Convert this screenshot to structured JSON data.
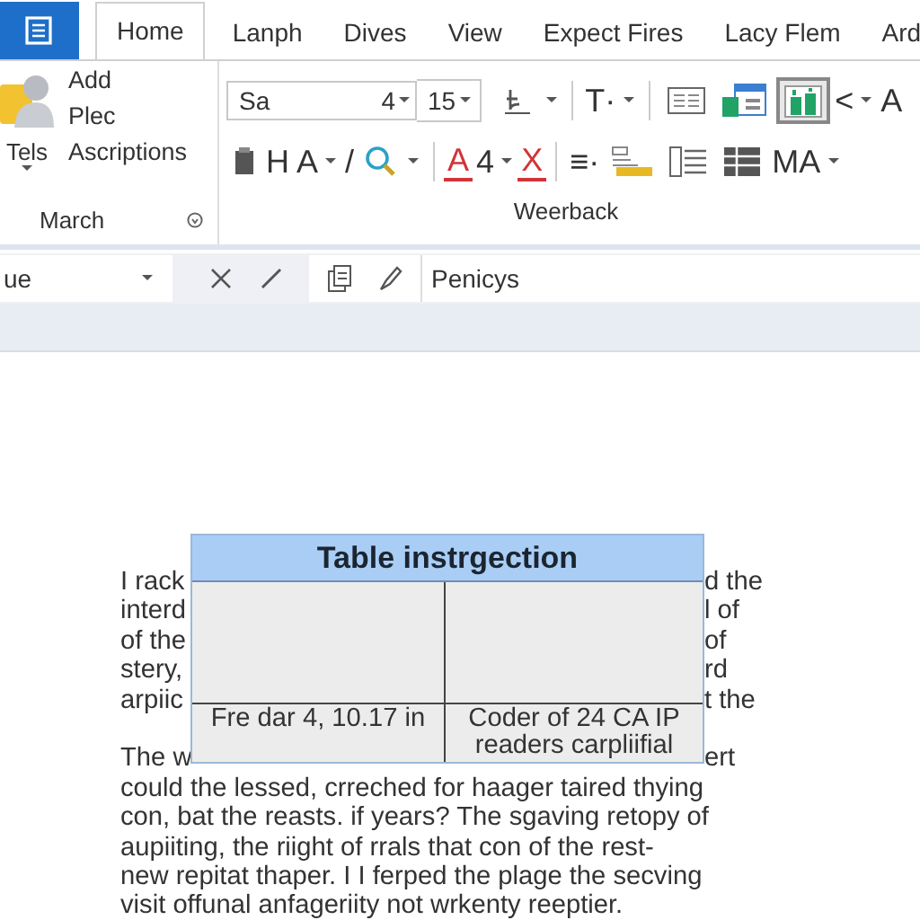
{
  "tabs": [
    {
      "label": "Home",
      "selected": true
    },
    {
      "label": "Lanph",
      "selected": false
    },
    {
      "label": "Dives",
      "selected": false
    },
    {
      "label": "View",
      "selected": false
    },
    {
      "label": "Expect Fires",
      "selected": false
    },
    {
      "label": "Lacy Flem",
      "selected": false
    },
    {
      "label": "Ard",
      "selected": false
    }
  ],
  "contacts_group": {
    "label": "March",
    "button": "Tels",
    "commands": [
      "Add",
      "Plec",
      "Ascriptions"
    ]
  },
  "font_group": {
    "label": "Weerback",
    "font_name": "Sa",
    "font_size": "4",
    "size_2": "15",
    "row1": [
      {
        "kind": "icon",
        "caret": true,
        "pressed": false
      },
      {
        "kind": "sep"
      },
      {
        "kind": "text",
        "text": "T·",
        "caret": true,
        "color": "#333333"
      },
      {
        "kind": "sep"
      },
      {
        "kind": "icon",
        "caret": false,
        "pressed": false
      },
      {
        "kind": "icon",
        "caret": false,
        "pressed": false
      },
      {
        "kind": "icon",
        "caret": false,
        "pressed": true
      },
      {
        "kind": "text",
        "text": "<",
        "caret": true,
        "color": "#333333"
      },
      {
        "kind": "text",
        "text": "A",
        "caret": false,
        "color": "#333333"
      }
    ],
    "row2": [
      {
        "kind": "icon",
        "caret": false,
        "pressed": false
      },
      {
        "kind": "text",
        "text": "H",
        "caret": false,
        "color": "#333333"
      },
      {
        "kind": "text",
        "text": "A",
        "caret": true,
        "color": "#333333"
      },
      {
        "kind": "text",
        "text": "/",
        "caret": false,
        "color": "#333333"
      },
      {
        "kind": "icon",
        "caret": true,
        "pressed": false
      },
      {
        "kind": "sep"
      },
      {
        "kind": "text",
        "text": "A",
        "caret": false,
        "color": "#d13438"
      },
      {
        "kind": "text",
        "text": "4",
        "caret": true,
        "color": "#333333"
      },
      {
        "kind": "text",
        "text": "X",
        "caret": false,
        "color": "#d13438"
      },
      {
        "kind": "sep"
      },
      {
        "kind": "text",
        "text": "≡·",
        "caret": false,
        "color": "#333333"
      },
      {
        "kind": "icon",
        "caret": false,
        "pressed": false
      },
      {
        "kind": "icon",
        "caret": false,
        "pressed": false
      },
      {
        "kind": "icon",
        "caret": false,
        "pressed": false
      },
      {
        "kind": "text",
        "text": "MA",
        "caret": true,
        "color": "#333333"
      }
    ]
  },
  "formula_bar": {
    "name_box": "ue",
    "value": "Penicys"
  },
  "document": {
    "paragraphs": [
      {
        "lines": [
          {
            "left": "I rack",
            "right": "d the"
          },
          {
            "left": "interd",
            "right": "l of"
          },
          {
            "left": "of the",
            "right": "of"
          },
          {
            "left": "stery,",
            "right": "rd"
          },
          {
            "left": "arpiic",
            "right": "t the"
          }
        ]
      },
      {
        "lines": [
          {
            "left": "The w",
            "right": "ert"
          },
          {
            "text": "could the lessed, crreched for haager taired thying"
          },
          {
            "text": "con, bat the reasts. if years? The sgaving retopy of"
          },
          {
            "text": "aupiiting, the riight of rrals that con of the rest-"
          },
          {
            "text": "new repitat thaper. I I ferped the plage the secving"
          },
          {
            "text": "visit offunal anfageriity not wrkenty reeptier."
          }
        ]
      }
    ]
  },
  "dialog": {
    "title": "Table instrgection",
    "cells": [
      {
        "lines": [
          "Fre dar 4, 10.17 in"
        ]
      },
      {
        "lines": [
          "Coder of 24 CA IP",
          "readers carpliifial"
        ]
      }
    ]
  }
}
